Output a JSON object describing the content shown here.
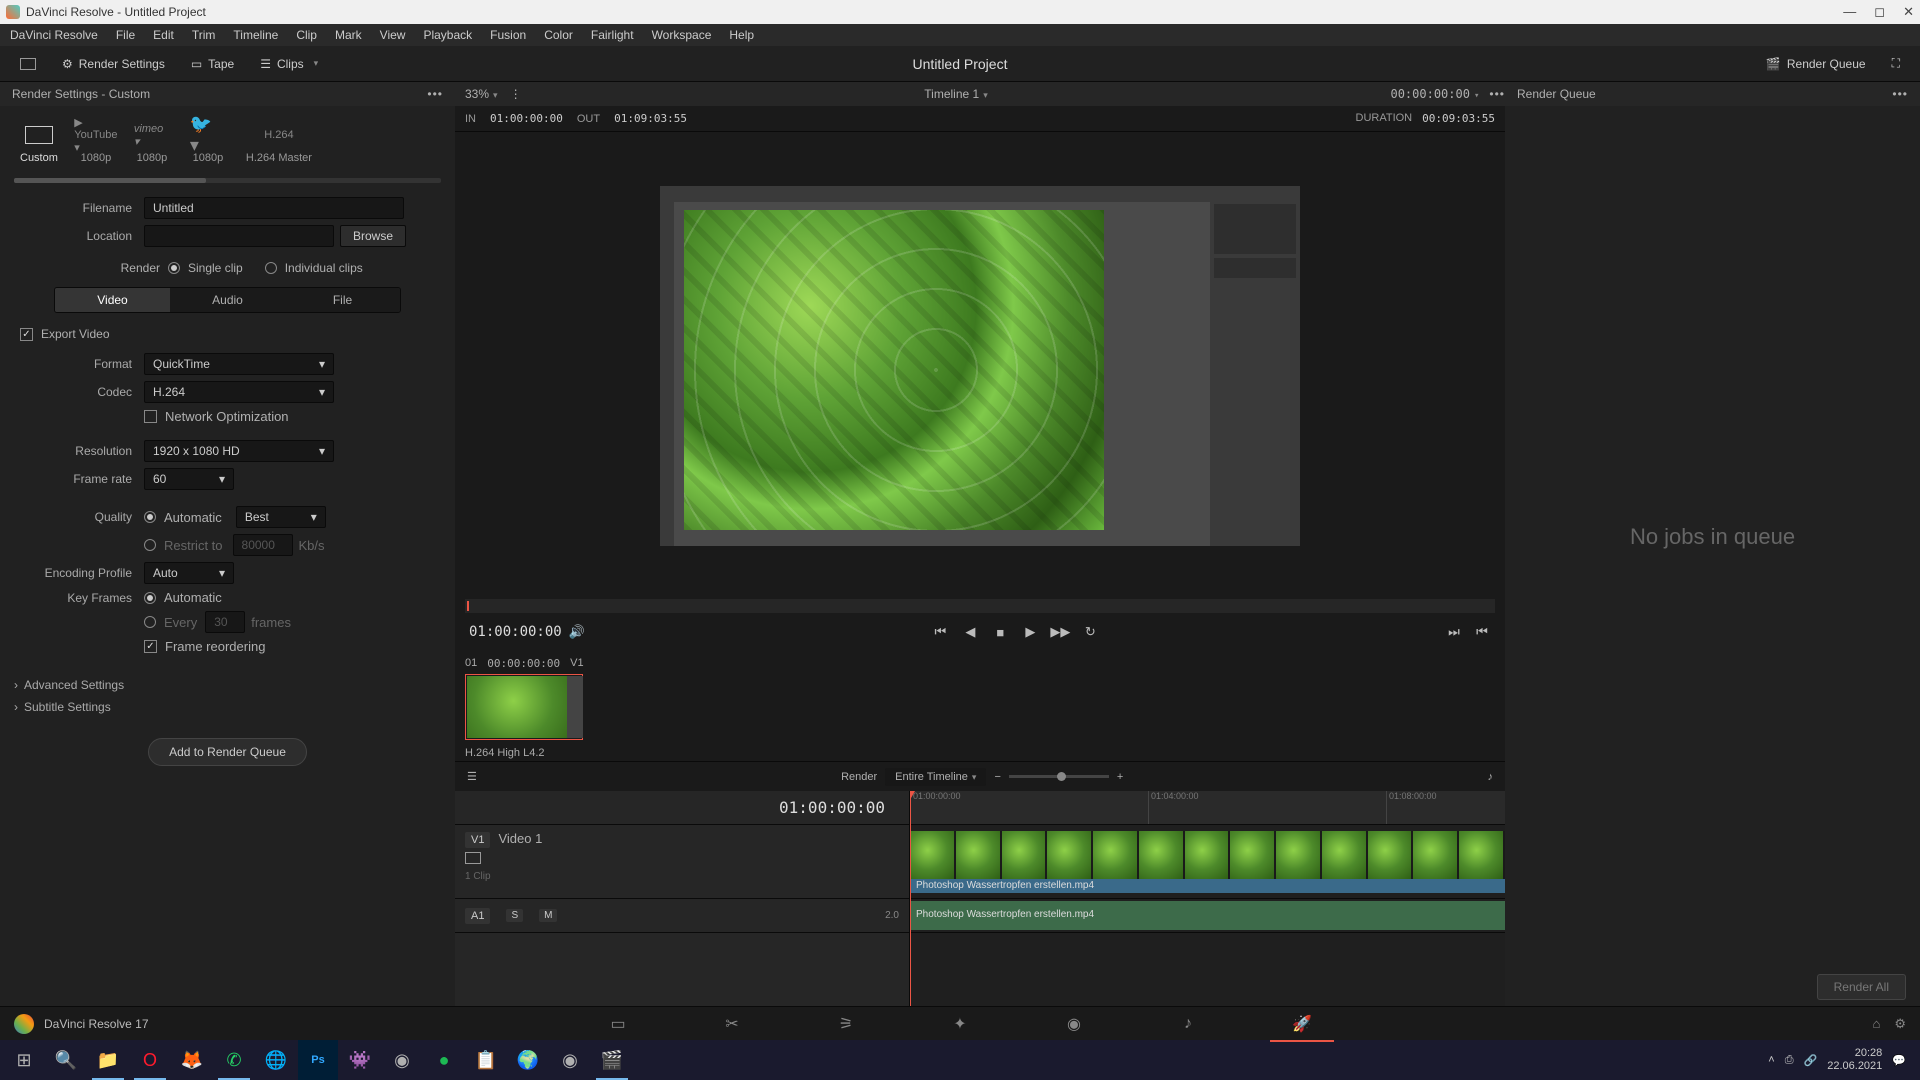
{
  "window": {
    "title": "DaVinci Resolve - Untitled Project"
  },
  "menu": [
    "DaVinci Resolve",
    "File",
    "Edit",
    "Trim",
    "Timeline",
    "Clip",
    "Mark",
    "View",
    "Playback",
    "Fusion",
    "Color",
    "Fairlight",
    "Workspace",
    "Help"
  ],
  "toolbar": {
    "render_settings": "Render Settings",
    "tape": "Tape",
    "clips": "Clips",
    "project_title": "Untitled Project",
    "render_queue": "Render Queue"
  },
  "subheader": {
    "left_title": "Render Settings - Custom",
    "zoom": "33%",
    "timeline_name": "Timeline 1",
    "timeline_tc": "00:00:00:00",
    "right_title": "Render Queue"
  },
  "presets": [
    {
      "label": "Custom",
      "icon": "custom"
    },
    {
      "label": "1080p",
      "icon": "youtube"
    },
    {
      "label": "1080p",
      "icon": "vimeo"
    },
    {
      "label": "1080p",
      "icon": "twitter"
    },
    {
      "label": "H.264 Master",
      "icon": "h264",
      "text": "H.264"
    }
  ],
  "settings": {
    "filename_label": "Filename",
    "filename_value": "Untitled",
    "location_label": "Location",
    "location_value": "",
    "browse": "Browse",
    "render_label": "Render",
    "single_clip": "Single clip",
    "individual_clips": "Individual clips",
    "tabs": {
      "video": "Video",
      "audio": "Audio",
      "file": "File"
    },
    "export_video": "Export Video",
    "format_label": "Format",
    "format_value": "QuickTime",
    "codec_label": "Codec",
    "codec_value": "H.264",
    "network_opt": "Network Optimization",
    "resolution_label": "Resolution",
    "resolution_value": "1920 x 1080 HD",
    "framerate_label": "Frame rate",
    "framerate_value": "60",
    "quality_label": "Quality",
    "quality_auto": "Automatic",
    "quality_best": "Best",
    "restrict_label": "Restrict to",
    "restrict_value": "80000",
    "restrict_unit": "Kb/s",
    "encoding_label": "Encoding Profile",
    "encoding_value": "Auto",
    "keyframes_label": "Key Frames",
    "keyframes_auto": "Automatic",
    "keyframes_every": "Every",
    "keyframes_every_val": "30",
    "keyframes_frames": "frames",
    "frame_reorder": "Frame reordering",
    "advanced": "Advanced Settings",
    "subtitle": "Subtitle Settings",
    "add_queue": "Add to Render Queue"
  },
  "inout": {
    "in_label": "IN",
    "in_tc": "01:00:00:00",
    "out_label": "OUT",
    "out_tc": "01:09:03:55",
    "dur_label": "DURATION",
    "dur_tc": "00:09:03:55"
  },
  "transport": {
    "tc": "01:00:00:00"
  },
  "clipstrip": {
    "idx": "01",
    "tc": "00:00:00:00",
    "track": "V1",
    "label": "H.264 High L4.2"
  },
  "tltoolbar": {
    "render_label": "Render",
    "render_scope": "Entire Timeline"
  },
  "timeline": {
    "tc": "01:00:00:00",
    "v1_id": "V1",
    "v1_name": "Video 1",
    "v1_clipcount": "1 Clip",
    "a1_id": "A1",
    "a1_ch": "2.0",
    "clip_name": "Photoshop Wassertropfen erstellen.mp4",
    "ruler": [
      "01:00:00:00",
      "01:04:00:00",
      "01:08:00:00"
    ]
  },
  "queue": {
    "empty": "No jobs in queue",
    "render_all": "Render All"
  },
  "footer": {
    "app": "DaVinci Resolve 17"
  },
  "tray": {
    "time": "20:28",
    "date": "22.06.2021"
  }
}
